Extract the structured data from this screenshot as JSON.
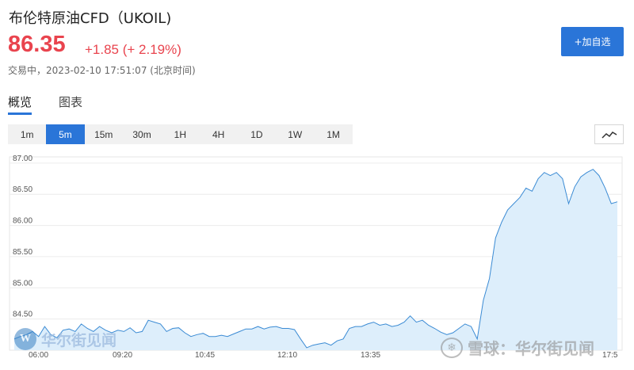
{
  "header": {
    "title": "布伦特原油CFD（UKOIL)",
    "price": "86.35",
    "change": "+1.85 (+ 2.19%)",
    "status": "交易中，2023-02-10 17:51:07 (北京时间)"
  },
  "actions": {
    "add_watchlist_label": "+加自选"
  },
  "tabs": {
    "overview_label": "概览",
    "chart_label": "图表"
  },
  "periods": [
    "1m",
    "5m",
    "15m",
    "30m",
    "1H",
    "4H",
    "1D",
    "1W",
    "1M"
  ],
  "selected_period": "5m",
  "watermarks": {
    "left": "华尔街见闻",
    "left_logo": "W",
    "right": "雪球：华尔街见闻",
    "right_logo": "❄"
  },
  "colors": {
    "accent": "#2a75d8",
    "up": "#e9444e",
    "line": "#3b8bd4",
    "fill": "#ddeefb"
  },
  "chart_data": {
    "type": "area",
    "ylim": [
      84.0,
      87.1
    ],
    "yticks": [
      "87.00",
      "86.50",
      "86.00",
      "85.50",
      "85.00",
      "84.50"
    ],
    "xticks": [
      "06:00",
      "09:20",
      "10:45",
      "12:10",
      "13:35",
      "17:5"
    ],
    "values": [
      84.18,
      84.22,
      84.25,
      84.3,
      84.22,
      84.38,
      84.25,
      84.2,
      84.32,
      84.34,
      84.3,
      84.42,
      84.35,
      84.3,
      84.38,
      84.32,
      84.28,
      84.32,
      84.3,
      84.36,
      84.28,
      84.3,
      84.48,
      84.45,
      84.42,
      84.3,
      84.35,
      84.36,
      84.28,
      84.22,
      84.25,
      84.27,
      84.22,
      84.22,
      84.24,
      84.22,
      84.26,
      84.3,
      84.34,
      84.34,
      84.38,
      84.34,
      84.37,
      84.38,
      84.35,
      84.35,
      84.33,
      84.18,
      84.04,
      84.08,
      84.1,
      84.12,
      84.08,
      84.15,
      84.18,
      84.35,
      84.38,
      84.38,
      84.42,
      84.45,
      84.4,
      84.42,
      84.38,
      84.4,
      84.45,
      84.55,
      84.45,
      84.48,
      84.4,
      84.35,
      84.29,
      84.25,
      84.28,
      84.35,
      84.42,
      84.38,
      84.18,
      84.8,
      85.15,
      85.8,
      86.05,
      86.25,
      86.35,
      86.45,
      86.6,
      86.55,
      86.75,
      86.85,
      86.8,
      86.85,
      86.75,
      86.35,
      86.62,
      86.78,
      86.85,
      86.9,
      86.8,
      86.6,
      86.35,
      86.38
    ]
  }
}
